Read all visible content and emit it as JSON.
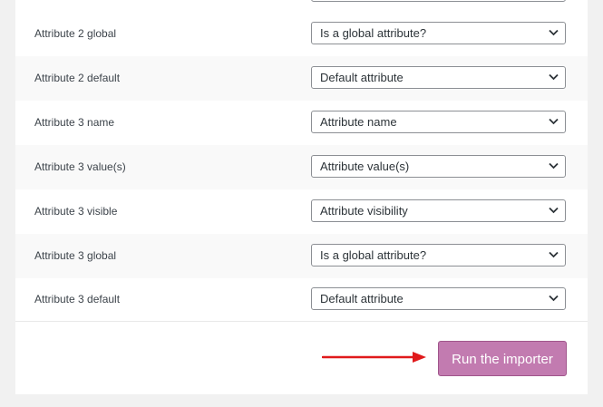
{
  "rows": [
    {
      "label": "Attribute 2 global",
      "value": "Is a global attribute?"
    },
    {
      "label": "Attribute 2 default",
      "value": "Default attribute"
    },
    {
      "label": "Attribute 3 name",
      "value": "Attribute name"
    },
    {
      "label": "Attribute 3 value(s)",
      "value": "Attribute value(s)"
    },
    {
      "label": "Attribute 3 visible",
      "value": "Attribute visibility"
    },
    {
      "label": "Attribute 3 global",
      "value": "Is a global attribute?"
    },
    {
      "label": "Attribute 3 default",
      "value": "Default attribute"
    }
  ],
  "actions": {
    "run_label": "Run the importer"
  },
  "icons": {
    "select_arrow": "chevron-down-icon",
    "pointer": "red-arrow-icon"
  },
  "colors": {
    "button_bg": "#c27bb0",
    "button_border": "#a0558b",
    "arrow": "#e0191b"
  }
}
